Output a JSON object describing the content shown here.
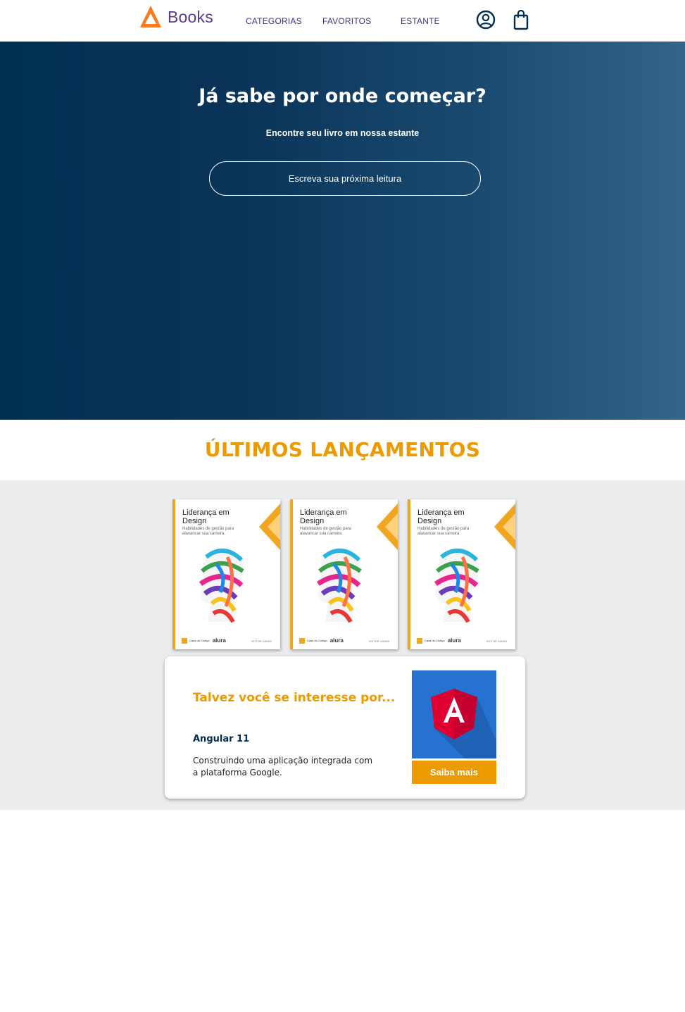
{
  "header": {
    "logo_text": "Books",
    "nav": [
      {
        "label": "CATEGORIAS"
      },
      {
        "label": "FAVORITOS"
      },
      {
        "label": "ESTANTE"
      }
    ],
    "icons": [
      "user-icon",
      "shopping-bag-icon"
    ]
  },
  "hero": {
    "title": "Já sabe por onde começar?",
    "subtitle": "Encontre seu livro em nossa estante",
    "search_placeholder": "Escreva sua próxima leitura"
  },
  "releases": {
    "heading": "ÚLTIMOS LANÇAMENTOS",
    "books": [
      {
        "title_line1": "Liderança em",
        "title_line2": "Design",
        "subtitle": "Habilidades de gestão para alavancar sua carreira",
        "publisher": "Casa do Código",
        "brand": "alura",
        "author": "VICTOR ZANINI"
      },
      {
        "title_line1": "Liderança em",
        "title_line2": "Design",
        "subtitle": "Habilidades de gestão para alavancar sua carreira",
        "publisher": "Casa do Código",
        "brand": "alura",
        "author": "VICTOR ZANINI"
      },
      {
        "title_line1": "Liderança em",
        "title_line2": "Design",
        "subtitle": "Habilidades de gestão para alavancar sua carreira",
        "publisher": "Casa do Código",
        "brand": "alura",
        "author": "VICTOR ZANINI"
      }
    ]
  },
  "suggestion": {
    "heading": "Talvez você se interesse por...",
    "book_title": "Angular 11",
    "description": "Construindo uma aplicação integrada com a plataforma Google.",
    "button_label": "Saiba mais",
    "image_icon": "angular-logo-icon"
  },
  "colors": {
    "accent": "#eb9b00",
    "navy": "#002f52",
    "nav_text": "#4b2e83",
    "gray_bg": "#ebeced"
  }
}
